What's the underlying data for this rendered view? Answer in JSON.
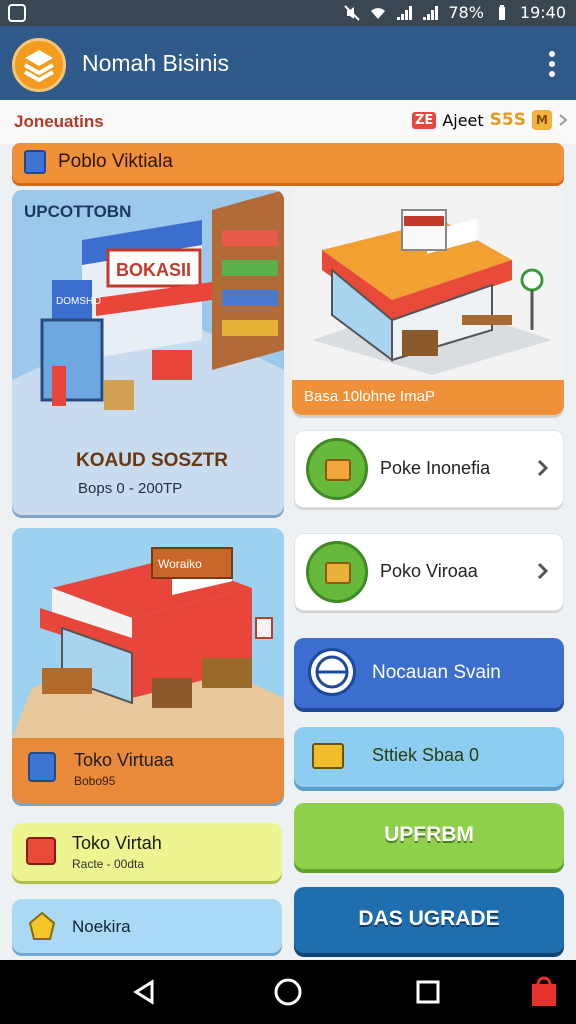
{
  "status": {
    "battery": "78%",
    "time": "19:40"
  },
  "appbar": {
    "title": "Nomah Bisinis"
  },
  "subhead": {
    "left": "Joneuatins",
    "tag": "ZE",
    "tag_text": "Ajeet",
    "coins": "S5S",
    "coin_box": "M"
  },
  "banner": {
    "label": "Poblo Viktiala"
  },
  "card_a": {
    "badge": "UPCOTTOBN",
    "title": "KOAUD SOSZTR",
    "price": "Bops 0 - 200TP",
    "sign_main": "BOKASII",
    "sign_side": "DOMSHO"
  },
  "card_b": {
    "footer": "Basa 10lohne ImaP"
  },
  "items": [
    {
      "label": "Poke Inonefia"
    },
    {
      "label": "Poko Viroaa"
    }
  ],
  "card_c": {
    "title": "Toko Virtuaa",
    "sub": "Bobo95",
    "sign": "Woraiko"
  },
  "buttons": {
    "blue": "Nocauan Svain",
    "sky": "Sttiek Sbaa 0",
    "green": "UPFRBM",
    "navy": "DAS UGRADE"
  },
  "small": {
    "yellow_title": "Toko Virtah",
    "yellow_sub": "Racte - 00dta",
    "blue_title": "Noekira"
  },
  "colors": {
    "appbar": "#2f5a89",
    "accent_orange": "#f0913a",
    "green": "#8fd04a",
    "blue": "#3c6ed0"
  }
}
